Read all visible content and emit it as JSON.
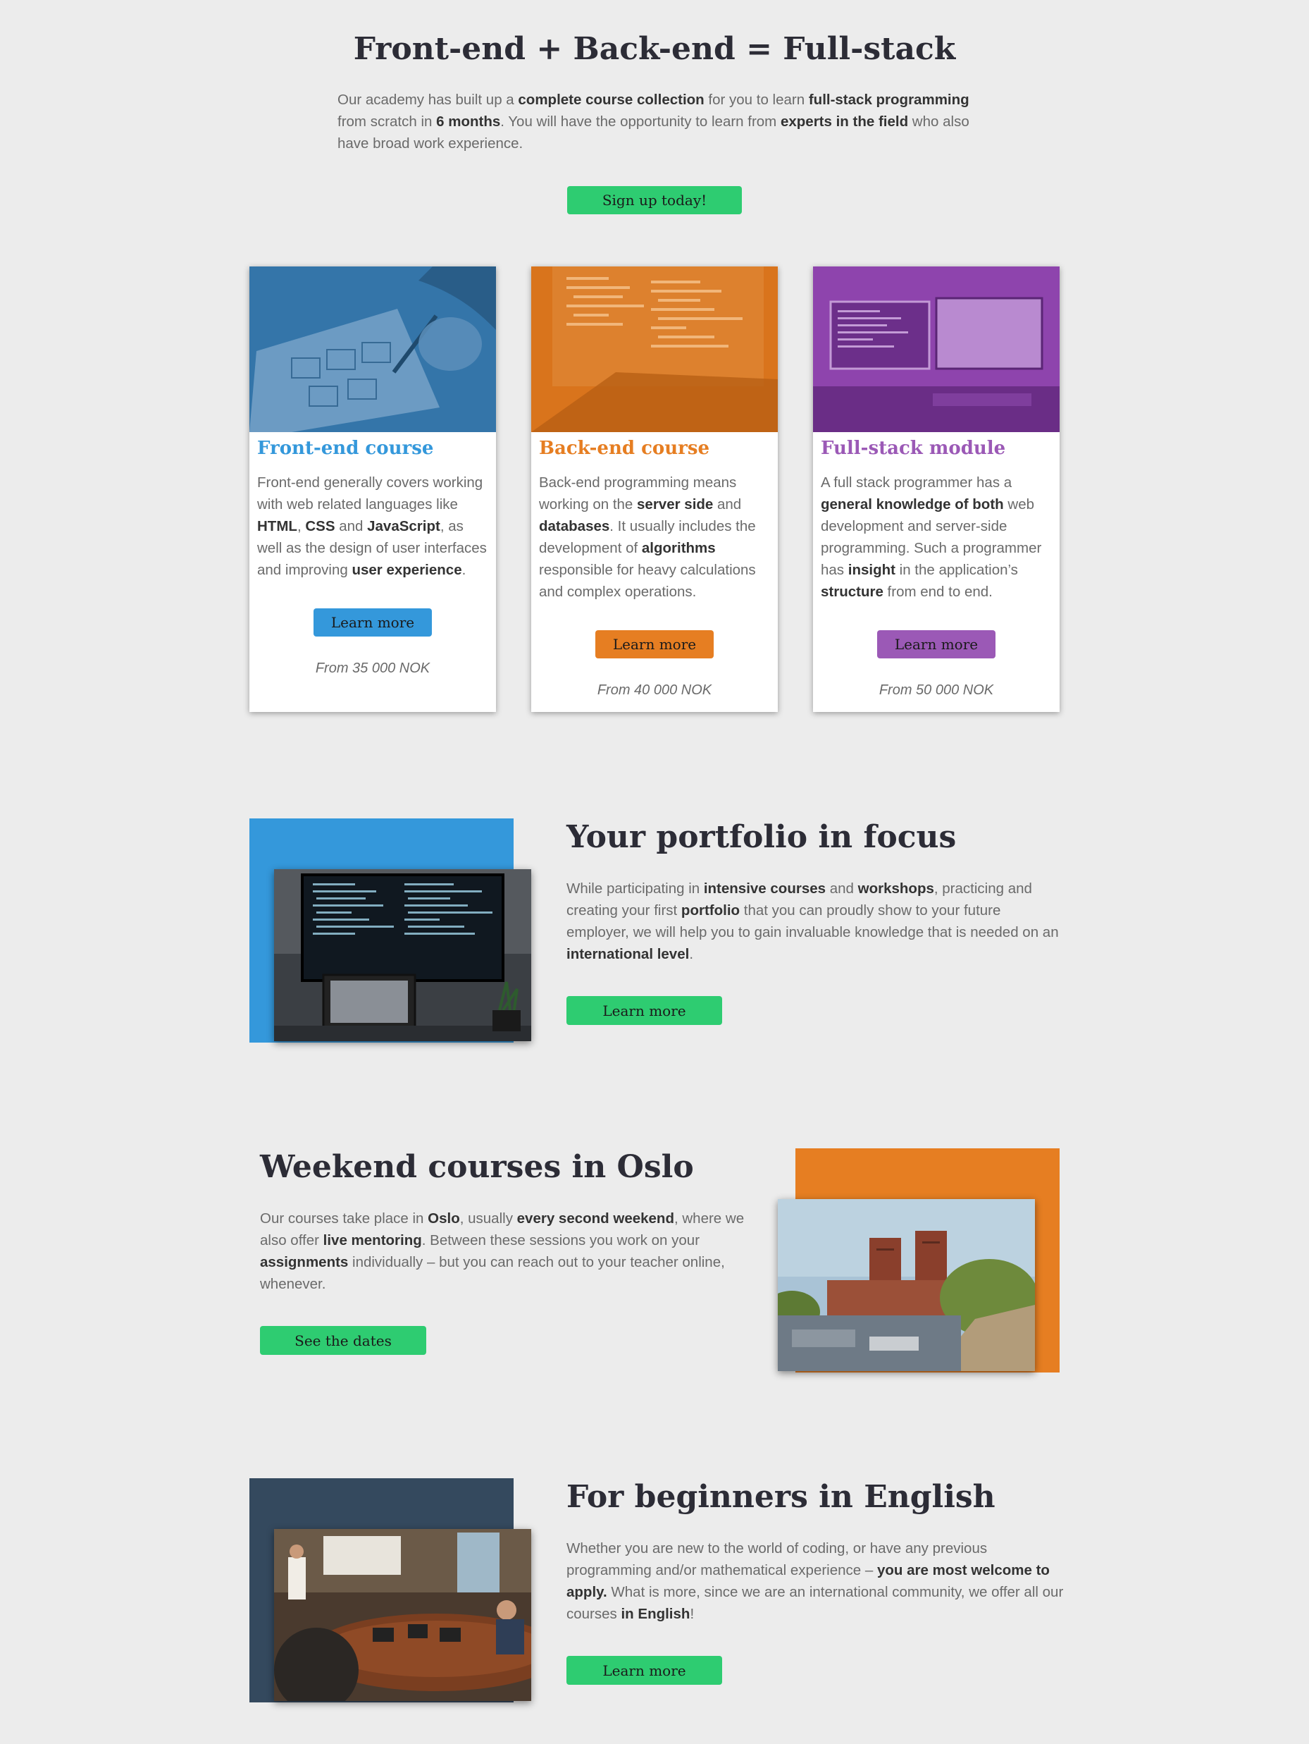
{
  "hero": {
    "title": "Front-end + Back-end = Full-stack",
    "intro": [
      {
        "t": "Our academy has built up a "
      },
      {
        "t": "complete course collection",
        "b": true
      },
      {
        "t": " for you to learn "
      },
      {
        "t": "full-stack programming",
        "b": true
      },
      {
        "t": " from scratch in "
      },
      {
        "t": "6 months",
        "b": true
      },
      {
        "t": ". You will have the opportunity to learn from "
      },
      {
        "t": "experts in the field",
        "b": true
      },
      {
        "t": " who also have broad work experience."
      }
    ],
    "cta_label": "Sign up today!"
  },
  "cards": [
    {
      "title": "Front-end course",
      "color": "#3498db",
      "image_icon": "wireframe-sketch-image",
      "desc": [
        {
          "t": "Front-end generally covers working with web related languages like "
        },
        {
          "t": "HTML",
          "b": true
        },
        {
          "t": ", "
        },
        {
          "t": "CSS",
          "b": true
        },
        {
          "t": " and "
        },
        {
          "t": "JavaScript",
          "b": true
        },
        {
          "t": ", as well as the design of user interfaces and improving "
        },
        {
          "t": "user experience",
          "b": true
        },
        {
          "t": "."
        }
      ],
      "button_label": "Learn more",
      "price": "From 35 000 NOK"
    },
    {
      "title": "Back-end course",
      "color": "#e67e22",
      "image_icon": "code-on-laptop-image",
      "desc": [
        {
          "t": "Back-end programming means working on the "
        },
        {
          "t": "server side",
          "b": true
        },
        {
          "t": " and "
        },
        {
          "t": "databases",
          "b": true
        },
        {
          "t": ". It usually includes the development of "
        },
        {
          "t": "algorithms",
          "b": true
        },
        {
          "t": " responsible for heavy calculations and complex operations."
        }
      ],
      "button_label": "Learn more",
      "price": "From 40 000 NOK"
    },
    {
      "title": "Full-stack module",
      "color": "#9b59b6",
      "image_icon": "dual-monitor-desk-image",
      "desc": [
        {
          "t": "A full stack programmer has a "
        },
        {
          "t": "general knowledge of both",
          "b": true
        },
        {
          "t": " web development and server-side programming. Such a programmer has "
        },
        {
          "t": "insight",
          "b": true
        },
        {
          "t": " in the application’s "
        },
        {
          "t": "structure",
          "b": true
        },
        {
          "t": " from end to end."
        }
      ],
      "button_label": "Learn more",
      "price": "From 50 000 NOK"
    }
  ],
  "portfolio": {
    "title": "Your portfolio in focus",
    "accent": "#3498db",
    "image_icon": "monitor-with-code-image",
    "text": [
      {
        "t": "While participating in "
      },
      {
        "t": "intensive courses",
        "b": true
      },
      {
        "t": " and "
      },
      {
        "t": "workshops",
        "b": true
      },
      {
        "t": ", practicing and creating your first "
      },
      {
        "t": "portfolio",
        "b": true
      },
      {
        "t": " that you can proudly show to your future employer, we will help you to gain invaluable knowledge that is needed on an "
      },
      {
        "t": "international level",
        "b": true
      },
      {
        "t": "."
      }
    ],
    "button_label": "Learn more"
  },
  "weekend": {
    "title": "Weekend courses in Oslo",
    "accent": "#e67e22",
    "image_icon": "oslo-city-hall-image",
    "text": [
      {
        "t": "Our courses take place in "
      },
      {
        "t": "Oslo",
        "b": true
      },
      {
        "t": ", usually "
      },
      {
        "t": "every second weekend",
        "b": true
      },
      {
        "t": ", where we also offer "
      },
      {
        "t": "live mentoring",
        "b": true
      },
      {
        "t": ". Between these sessions you work on your "
      },
      {
        "t": "assignments",
        "b": true
      },
      {
        "t": " individually – but you can reach out to your teacher online, whenever."
      }
    ],
    "button_label": "See the dates"
  },
  "beginners": {
    "title": "For beginners in English",
    "accent": "#34495e",
    "image_icon": "classroom-meeting-image",
    "text": [
      {
        "t": "Whether you are new to the world of coding, or have any previous programming and/or mathematical experience – "
      },
      {
        "t": "you are most welcome to apply.",
        "b": true
      },
      {
        "t": " What is more, since we are an international community, we offer all our courses "
      },
      {
        "t": "in English",
        "b": true
      },
      {
        "t": "!"
      }
    ],
    "button_label": "Learn more"
  }
}
